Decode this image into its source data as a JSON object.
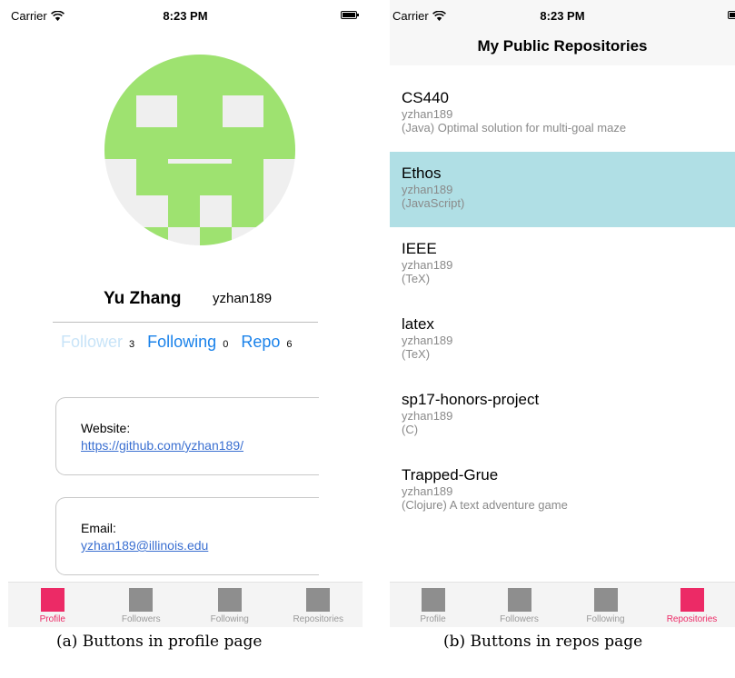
{
  "colors": {
    "tint": "#1a82ea",
    "accent": "#ec2a66",
    "selection": "#b0dfe5",
    "identicon": "#9ee270"
  },
  "status_bar": {
    "carrier": "Carrier",
    "time": "8:23 PM",
    "wifi_icon": "wifi-icon",
    "battery_icon": "battery-icon"
  },
  "profile_page": {
    "avatar_icon": "identicon-avatar",
    "name": "Yu Zhang",
    "login": "yzhan189",
    "stats": {
      "follower_label": "Follower",
      "follower_count": "3",
      "following_label": "Following",
      "following_count": "0",
      "repo_label": "Repo",
      "repo_count": "6"
    },
    "website": {
      "label": "Website:",
      "value": "https://github.com/yzhan189/"
    },
    "email": {
      "label": "Email:",
      "value": "yzhan189@illinois.edu"
    }
  },
  "repos_page": {
    "title": "My Public Repositories",
    "repos": [
      {
        "name": "CS440",
        "owner": "yzhan189",
        "description": "(Java) Optimal solution for multi-goal maze"
      },
      {
        "name": "Ethos",
        "owner": "yzhan189",
        "description": "(JavaScript)"
      },
      {
        "name": "IEEE",
        "owner": "yzhan189",
        "description": "(TeX)"
      },
      {
        "name": "latex",
        "owner": "yzhan189",
        "description": "(TeX)"
      },
      {
        "name": "sp17-honors-project",
        "owner": "yzhan189",
        "description": "(C)"
      },
      {
        "name": "Trapped-Grue",
        "owner": "yzhan189",
        "description": "(Clojure) A text adventure game"
      }
    ]
  },
  "tab_bar": {
    "tabs": [
      {
        "label": "Profile",
        "icon": "profile-tab-icon"
      },
      {
        "label": "Followers",
        "icon": "followers-tab-icon"
      },
      {
        "label": "Following",
        "icon": "following-tab-icon"
      },
      {
        "label": "Repositories",
        "icon": "repositories-tab-icon"
      }
    ]
  },
  "captions": {
    "a": "(a) Buttons in profile page",
    "b": "(b) Buttons in repos page"
  }
}
